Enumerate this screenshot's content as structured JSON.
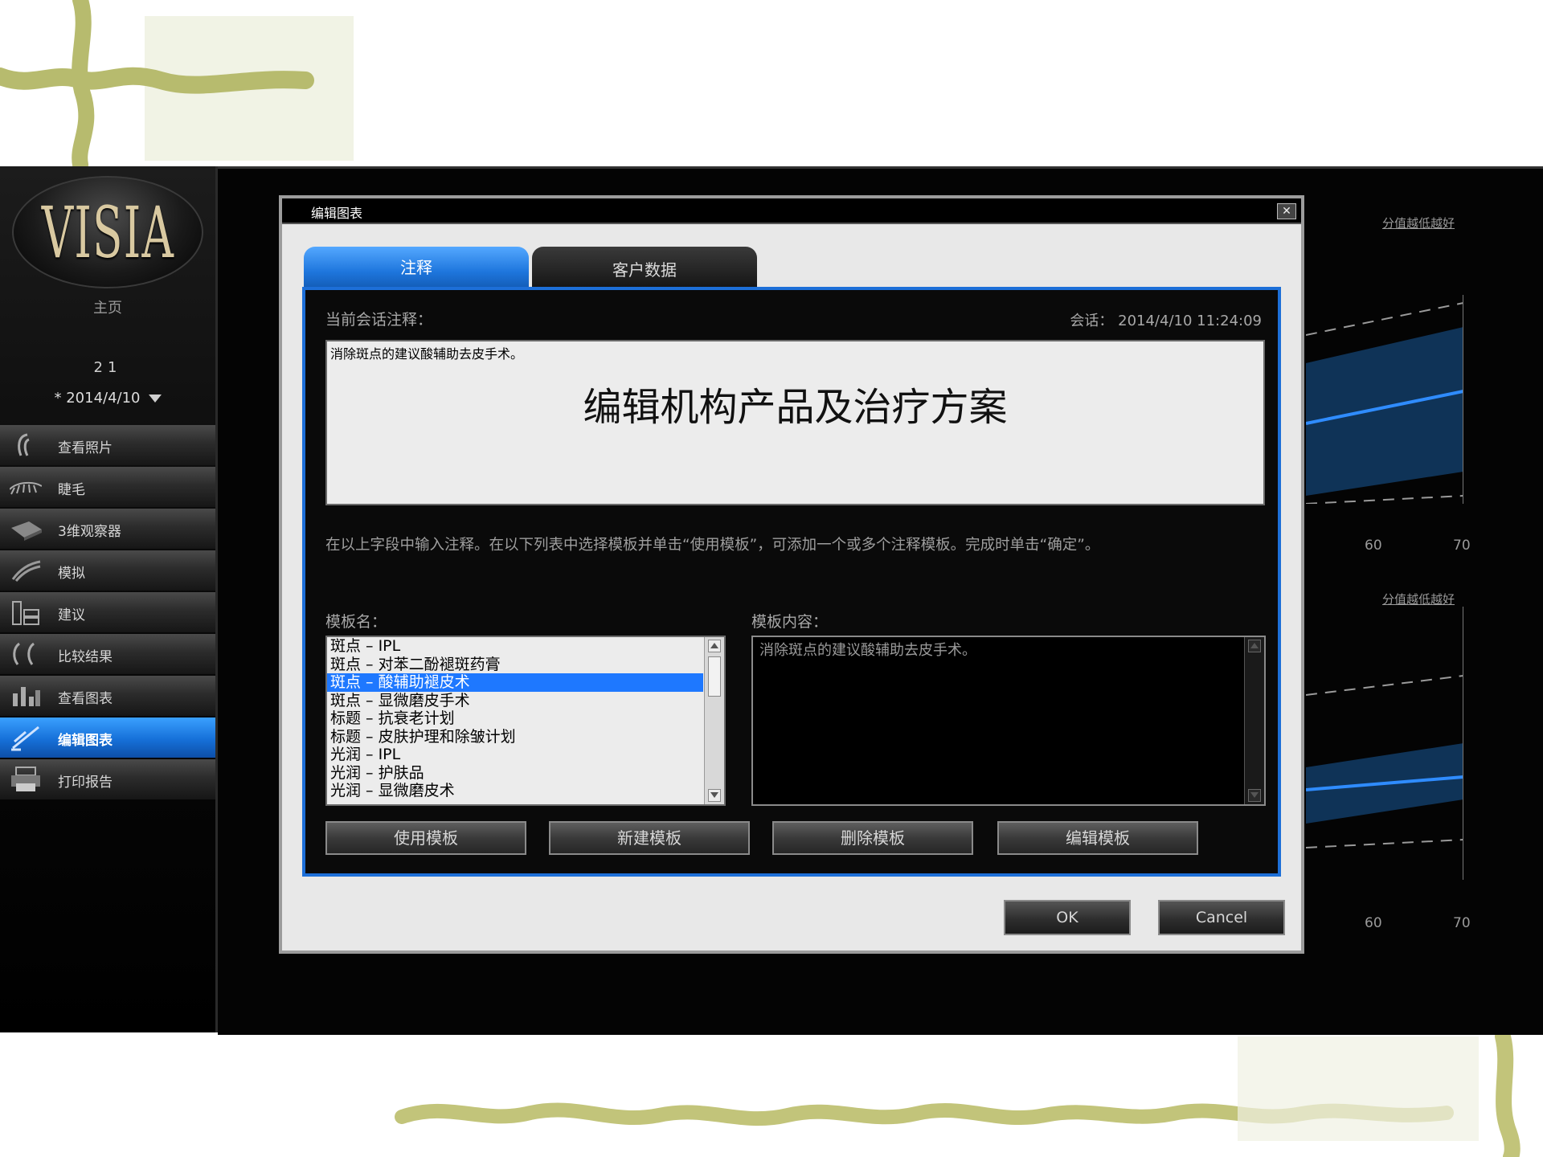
{
  "app": {
    "logo": "VISIA",
    "sidebar": {
      "home_label": "主页",
      "session_number": "21",
      "session_date": "* 2014/4/10",
      "items": [
        {
          "label": "查看照片",
          "icon": "face-icon"
        },
        {
          "label": "睫毛",
          "icon": "eyelash-icon"
        },
        {
          "label": "3维观察器",
          "icon": "3d-viewer-icon"
        },
        {
          "label": "模拟",
          "icon": "simulate-icon"
        },
        {
          "label": "建议",
          "icon": "recommend-icon"
        },
        {
          "label": "比较结果",
          "icon": "compare-icon"
        },
        {
          "label": "查看图表",
          "icon": "chart-icon"
        },
        {
          "label": "编辑图表",
          "icon": "edit-chart-icon",
          "active": true
        },
        {
          "label": "打印报告",
          "icon": "printer-icon"
        }
      ]
    },
    "background_charts": [
      {
        "title": "分值越低越好",
        "ticks": [
          "60",
          "70"
        ]
      },
      {
        "title": "分值越低越好",
        "ticks": [
          "60",
          "70"
        ]
      }
    ]
  },
  "dialog": {
    "title": "编辑图表",
    "close_label": "✕",
    "tabs": [
      {
        "label": "注释",
        "active": true
      },
      {
        "label": "客户数据",
        "active": false
      }
    ],
    "current_notes_label": "当前会话注释：",
    "session_label": "会话：  2014/4/10 11:24:09",
    "notes_text": "消除斑点的建议酸辅助去皮手术。",
    "notes_overlay": "编辑机构产品及治疗方案",
    "instructions": "在以上字段中输入注释。在以下列表中选择模板并单击“使用模板”，可添加一个或多个注释模板。完成时单击“确定”。",
    "template_name_label": "模板名：",
    "template_content_label": "模板内容：",
    "templates": [
      "斑点 – IPL",
      "斑点 – 对苯二酚褪斑药膏",
      "斑点 – 酸辅助褪皮术",
      "斑点 – 显微磨皮手术",
      "标题 – 抗衰老计划",
      "标题 – 皮肤护理和除皱计划",
      "光润 – IPL",
      "光润 – 护肤品",
      "光润 – 显微磨皮术"
    ],
    "selected_template_index": 2,
    "template_content": "消除斑点的建议酸辅助去皮手术。",
    "buttons": {
      "use": "使用模板",
      "new": "新建模板",
      "delete": "删除模板",
      "edit": "编辑模板",
      "ok": "OK",
      "cancel": "Cancel"
    }
  }
}
